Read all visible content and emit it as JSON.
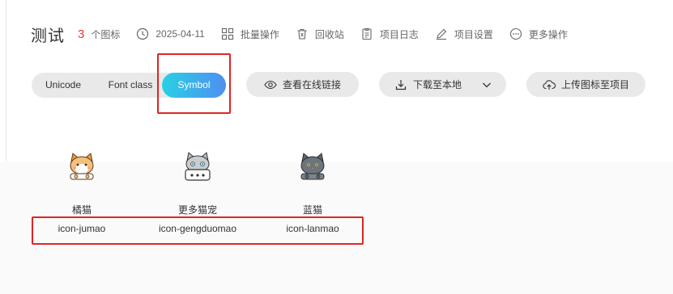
{
  "header": {
    "title": "测试",
    "count": "3",
    "count_label": "个图标",
    "items": [
      {
        "icon": "clock-icon",
        "label": "2025-04-11"
      },
      {
        "icon": "batch-icon",
        "label": "批量操作"
      },
      {
        "icon": "trash-icon",
        "label": "回收站"
      },
      {
        "icon": "log-icon",
        "label": "项目日志"
      },
      {
        "icon": "edit-icon",
        "label": "项目设置"
      },
      {
        "icon": "more-icon",
        "label": "更多操作"
      }
    ]
  },
  "toolbar": {
    "tabs": [
      "Unicode",
      "Font class",
      "Symbol"
    ],
    "active_tab": "Symbol",
    "view_link": "查看在线链接",
    "download": "下载至本地",
    "upload": "上传图标至项目"
  },
  "icons": [
    {
      "name": "橘猫",
      "code": "icon-jumao",
      "color": "#f0a040"
    },
    {
      "name": "更多猫宠",
      "code": "icon-gengduomao",
      "color": "#9aa0a6"
    },
    {
      "name": "蓝猫",
      "code": "icon-lanmao",
      "color": "#5e666e"
    }
  ],
  "colors": {
    "accent_gradient_start": "#29d0e6",
    "accent_gradient_end": "#4f8ff0",
    "count_red": "#e23b3b",
    "annotation_red": "#e02424"
  }
}
